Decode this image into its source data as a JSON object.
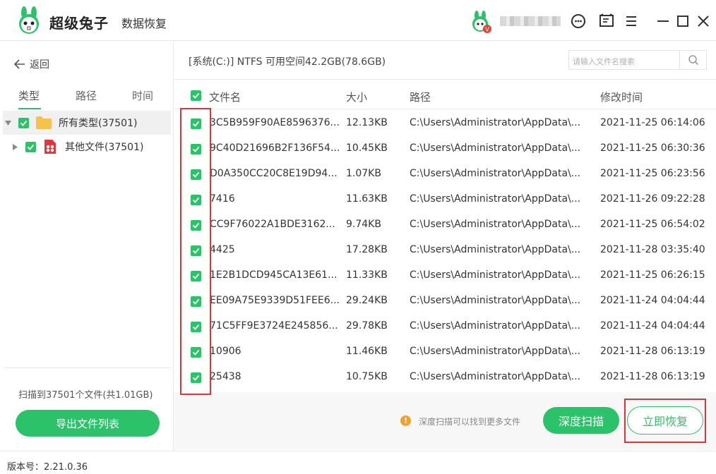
{
  "app": {
    "name": "超级兔子",
    "subtitle": "数据恢复",
    "accent_color": "#2cc26a",
    "highlight_color": "#d9353a"
  },
  "titlebar": {
    "icons": [
      "customer-service-icon",
      "feedback-icon",
      "menu-icon",
      "minimize-icon",
      "maximize-icon",
      "close-icon"
    ],
    "vip_badge": "V"
  },
  "sidebar": {
    "back_label": "返回",
    "tabs": [
      {
        "label": "类型",
        "active": true
      },
      {
        "label": "路径",
        "active": false
      },
      {
        "label": "时间",
        "active": false
      }
    ],
    "tree": [
      {
        "label": "所有类型(37501)",
        "icon": "folder-icon",
        "checked": true,
        "expanded": true
      },
      {
        "label": "其他文件(37501)",
        "icon": "file-icon",
        "checked": true,
        "expanded": false
      }
    ],
    "scan_summary": "扫描到37501个文件(共1.01GB)",
    "export_label": "导出文件列表"
  },
  "path_bar": {
    "text": "[系统(C:)] NTFS 可用空间42.2GB(78.6GB)",
    "search_placeholder": "请输入文件名搜索"
  },
  "table": {
    "headers": {
      "name": "文件名",
      "size": "大小",
      "path": "路径",
      "time": "修改时间"
    },
    "rows": [
      {
        "name": "3C5B959F90AE8596376...",
        "size": "12.13KB",
        "path": "C:\\Users\\Administrator\\AppData\\...",
        "time": "2021-11-25 06:14:06"
      },
      {
        "name": "9C40D21696B2F136F54...",
        "size": "10.45KB",
        "path": "C:\\Users\\Administrator\\AppData\\...",
        "time": "2021-11-25 06:30:36"
      },
      {
        "name": "D0A350CC20C8E19D94...",
        "size": "1.07KB",
        "path": "C:\\Users\\Administrator\\AppData\\...",
        "time": "2021-11-25 06:23:56"
      },
      {
        "name": "7416",
        "size": "11.63KB",
        "path": "C:\\Users\\Administrator\\AppData\\...",
        "time": "2021-11-26 09:22:28"
      },
      {
        "name": "CC9F76022A1BDE3162...",
        "size": "9.74KB",
        "path": "C:\\Users\\Administrator\\AppData\\...",
        "time": "2021-11-25 06:54:02"
      },
      {
        "name": "4425",
        "size": "17.28KB",
        "path": "C:\\Users\\Administrator\\AppData\\...",
        "time": "2021-11-28 03:35:40"
      },
      {
        "name": "1E2B1DCD945CA13E61...",
        "size": "11.33KB",
        "path": "C:\\Users\\Administrator\\AppData\\...",
        "time": "2021-11-25 06:26:15"
      },
      {
        "name": "EE09A75E9339D51FEE6...",
        "size": "29.24KB",
        "path": "C:\\Users\\Administrator\\AppData\\...",
        "time": "2021-11-24 04:04:44"
      },
      {
        "name": "71C5FF9E3724E245856...",
        "size": "29.78KB",
        "path": "C:\\Users\\Administrator\\AppData\\...",
        "time": "2021-11-24 04:04:44"
      },
      {
        "name": "10906",
        "size": "11.46KB",
        "path": "C:\\Users\\Administrator\\AppData\\...",
        "time": "2021-11-28 06:13:19"
      },
      {
        "name": "25438",
        "size": "10.75KB",
        "path": "C:\\Users\\Administrator\\AppData\\...",
        "time": "2021-11-28 06:13:19"
      }
    ]
  },
  "actions": {
    "tip": "深度扫描可以找到更多文件",
    "tip_icon": "!",
    "deep_scan_label": "深度扫描",
    "recover_label": "立即恢复"
  },
  "footer": {
    "version": "版本号：2.21.0.36"
  }
}
